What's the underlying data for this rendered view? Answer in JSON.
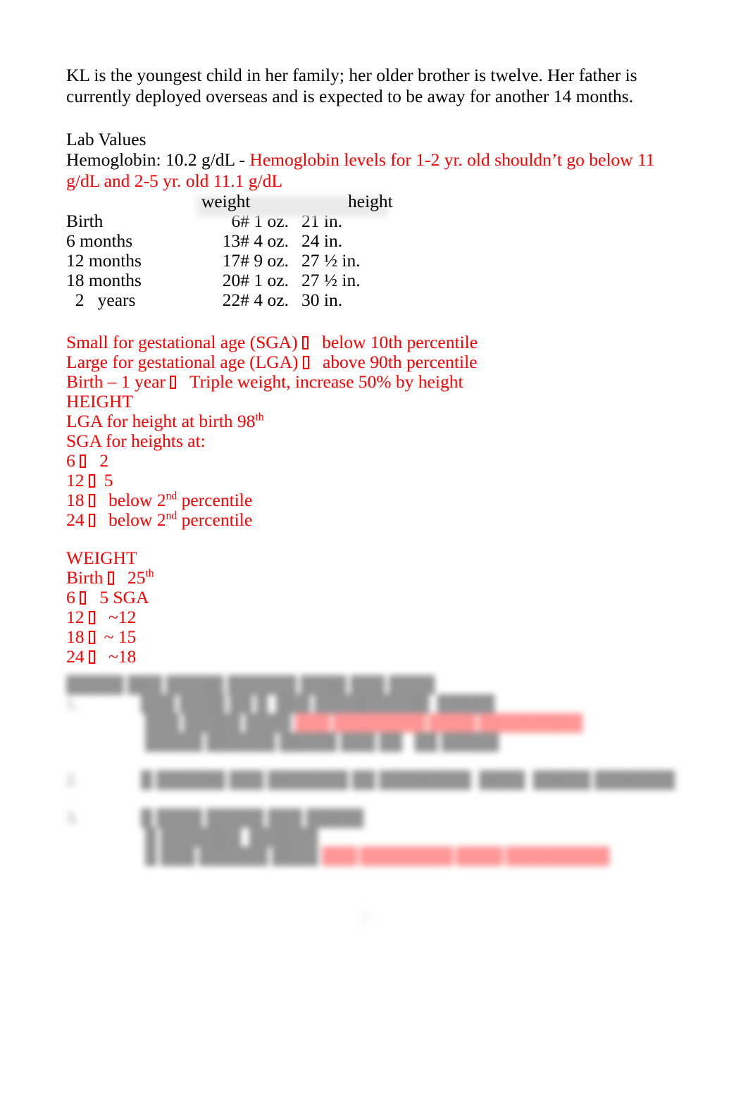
{
  "document": {
    "intro_paragraph": " KL is the youngest child in her family; her older brother is twelve. Her father is currently deployed overseas and is expected to be away for another 14 months.",
    "lab_values_heading": "Lab Values",
    "hemoglobin_label": "Hemoglobin:  10.2 g/dL - ",
    "hemoglobin_note": "Hemoglobin levels for 1-2 yr. old shouldn’t go below 11 g/dL and 2-5 yr. old 11.1 g/dL"
  },
  "growth_table": {
    "headers": [
      "",
      "weight",
      "height"
    ],
    "rows": [
      {
        "age": "Birth",
        "weight": "6# 1 oz.",
        "height": "21 in."
      },
      {
        "age": "6 months",
        "weight": "13# 4 oz.",
        "height": "24 in."
      },
      {
        "age": "12 months",
        "weight": "17# 9 oz.",
        "height": "27 ½ in."
      },
      {
        "age": "18 months",
        "weight": "20# 1 oz.",
        "height": "27 ½ in."
      },
      {
        "age": "  2   years",
        "weight": "22# 4 oz.",
        "height": "30 in."
      }
    ]
  },
  "notes": {
    "sga_definition_label": "Small for gestational age (SGA) ",
    "sga_definition_value": "   below 10th percentile",
    "lga_definition_label": "Large for gestational age (LGA) ",
    "lga_definition_value": "   above 90th percentile",
    "birth_1year_label": "Birth – 1 year ",
    "birth_1year_value": "   Triple weight, increase 50% by height",
    "height_heading": "HEIGHT",
    "lga_height_birth_pre": "LGA for height at birth 98",
    "lga_height_birth_sup": "th",
    "sga_heights_heading": "SGA for heights at:",
    "height_rows": [
      {
        "age": "6 ",
        "value": "   2"
      },
      {
        "age": "12 ",
        "value": "  5"
      },
      {
        "age": "18 ",
        "value": "   below 2",
        "sup": "nd",
        "tail": " percentile"
      },
      {
        "age": "24 ",
        "value": "   below 2",
        "sup": "nd",
        "tail": " percentile"
      }
    ],
    "weight_heading": "WEIGHT",
    "weight_rows": [
      {
        "age": "Birth ",
        "value": "   25",
        "sup": "th",
        "tail": ""
      },
      {
        "age": "6 ",
        "value": "   5 SGA"
      },
      {
        "age": "12 ",
        "value": "   ~12"
      },
      {
        "age": "18 ",
        "value": "  ~ 15"
      },
      {
        "age": "24 ",
        "value": "   ~18"
      }
    ]
  },
  "redacted_section": {
    "note": "blurred / illegible text block",
    "lines": [
      {
        "marker": "",
        "text": "█████ ███ █████ ██████ ████ ███ ████"
      },
      {
        "marker": "1.",
        "text": "███ ████ ██ █  ███ ██████████  █████"
      },
      {
        "marker": "",
        "text": "███ █████ ████",
        "redtext": "███ ████████ ████ █████████"
      },
      {
        "marker": "",
        "text": "█████ ██████ █████ ███ ██   ██ █████"
      },
      {
        "marker": "2.",
        "text": "█ ██████ ███ ███████ ██ ████████  ████  █████ ███████"
      },
      {
        "marker": "3.",
        "text": "█ ████ █████ ███ █████"
      },
      {
        "marker": "",
        "text": "█ ███████  ██████"
      },
      {
        "marker": "",
        "text": "█ ███ ██████ ████",
        "redtext": "███ ████████ ████ █████████"
      }
    ]
  },
  "footer": {
    "page_number": "2"
  },
  "colors": {
    "annotation_red": "#ff0000",
    "body_black": "#000000",
    "page_background": "#ffffff",
    "highlight_haze": "#eaeaea"
  }
}
